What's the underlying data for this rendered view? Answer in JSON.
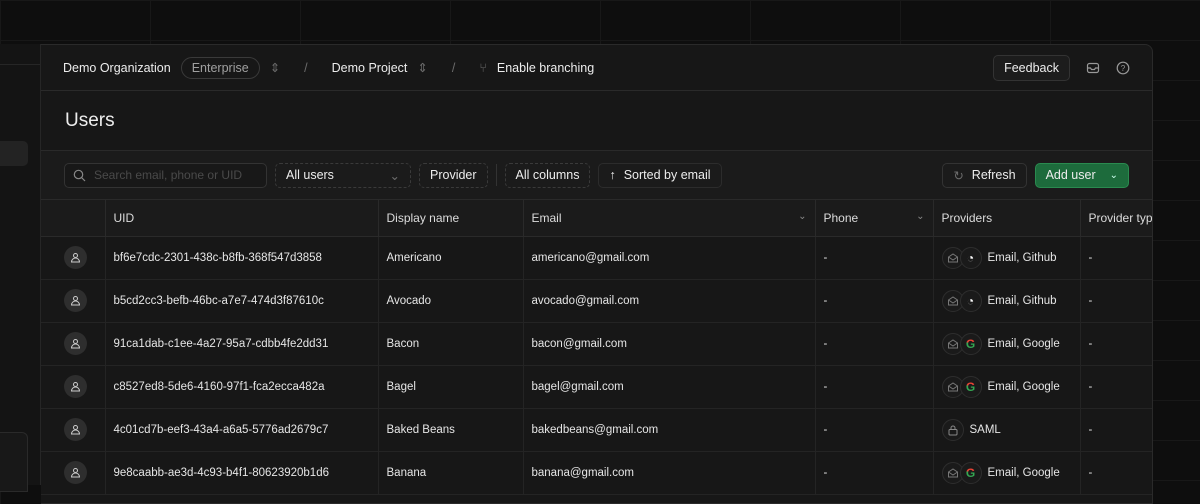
{
  "header": {
    "org": "Demo Organization",
    "plan": "Enterprise",
    "project": "Demo Project",
    "branching": "Enable branching",
    "feedback": "Feedback",
    "sep": "/"
  },
  "page": {
    "title": "Users"
  },
  "toolbar": {
    "search_placeholder": "Search email, phone or UID",
    "filter": "All users",
    "provider": "Provider",
    "columns": "All columns",
    "sort": "Sorted by email",
    "refresh": "Refresh",
    "add_user": "Add user"
  },
  "columns": [
    "UID",
    "Display name",
    "Email",
    "Phone",
    "Providers",
    "Provider typ"
  ],
  "colors": {
    "accent": "#1d6b3c"
  },
  "rows": [
    {
      "uid": "bf6e7cdc-2301-438c-b8fb-368f547d3858",
      "name": "Americano",
      "email": "americano@gmail.com",
      "phone": "-",
      "providers": "Email, Github",
      "icons": [
        "email-icon",
        "github-icon"
      ],
      "ptype": "-"
    },
    {
      "uid": "b5cd2cc3-befb-46bc-a7e7-474d3f87610c",
      "name": "Avocado",
      "email": "avocado@gmail.com",
      "phone": "-",
      "providers": "Email, Github",
      "icons": [
        "email-icon",
        "github-icon"
      ],
      "ptype": "-"
    },
    {
      "uid": "91ca1dab-c1ee-4a27-95a7-cdbb4fe2dd31",
      "name": "Bacon",
      "email": "bacon@gmail.com",
      "phone": "-",
      "providers": "Email, Google",
      "icons": [
        "email-icon",
        "google-icon"
      ],
      "ptype": "-"
    },
    {
      "uid": "c8527ed8-5de6-4160-97f1-fca2ecca482a",
      "name": "Bagel",
      "email": "bagel@gmail.com",
      "phone": "-",
      "providers": "Email, Google",
      "icons": [
        "email-icon",
        "google-icon"
      ],
      "ptype": "-"
    },
    {
      "uid": "4c01cd7b-eef3-43a4-a6a5-5776ad2679c7",
      "name": "Baked Beans",
      "email": "bakedbeans@gmail.com",
      "phone": "-",
      "providers": "SAML",
      "icons": [
        "lock-icon"
      ],
      "ptype": "-"
    },
    {
      "uid": "9e8caabb-ae3d-4c93-b4f1-80623920b1d6",
      "name": "Banana",
      "email": "banana@gmail.com",
      "phone": "-",
      "providers": "Email, Google",
      "icons": [
        "email-icon",
        "google-icon"
      ],
      "ptype": "-"
    }
  ]
}
